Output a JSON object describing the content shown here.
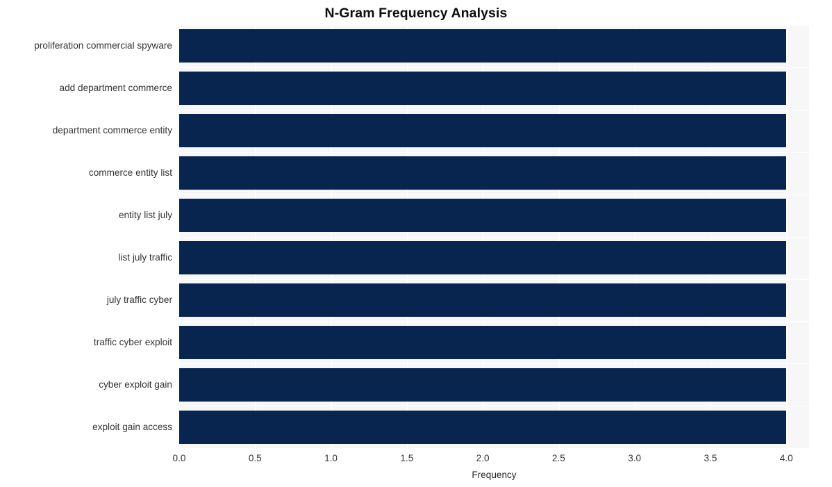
{
  "chart_data": {
    "type": "bar",
    "orientation": "horizontal",
    "title": "N-Gram Frequency Analysis",
    "xlabel": "Frequency",
    "ylabel": "",
    "categories": [
      "proliferation commercial spyware",
      "add department commerce",
      "department commerce entity",
      "commerce entity list",
      "entity list july",
      "list july traffic",
      "july traffic cyber",
      "traffic cyber exploit",
      "cyber exploit gain",
      "exploit gain access"
    ],
    "values": [
      4,
      4,
      4,
      4,
      4,
      4,
      4,
      4,
      4,
      4
    ],
    "xlim": [
      0,
      4.15
    ],
    "xticks": [
      0,
      0.5,
      1,
      1.5,
      2,
      2.5,
      3,
      3.5,
      4
    ],
    "xticklabels": [
      "0.0",
      "0.5",
      "1.0",
      "1.5",
      "2.0",
      "2.5",
      "3.0",
      "3.5",
      "4.0"
    ],
    "grid": true,
    "grid_axis": "both",
    "legend": false,
    "bar_color": "#07254f",
    "plot_background": "#f7f7f7",
    "gridline_color": "#ffffff",
    "figure_background": "#ffffff",
    "tick_label_color": "#333333",
    "title_color": "#0d0d0d"
  }
}
